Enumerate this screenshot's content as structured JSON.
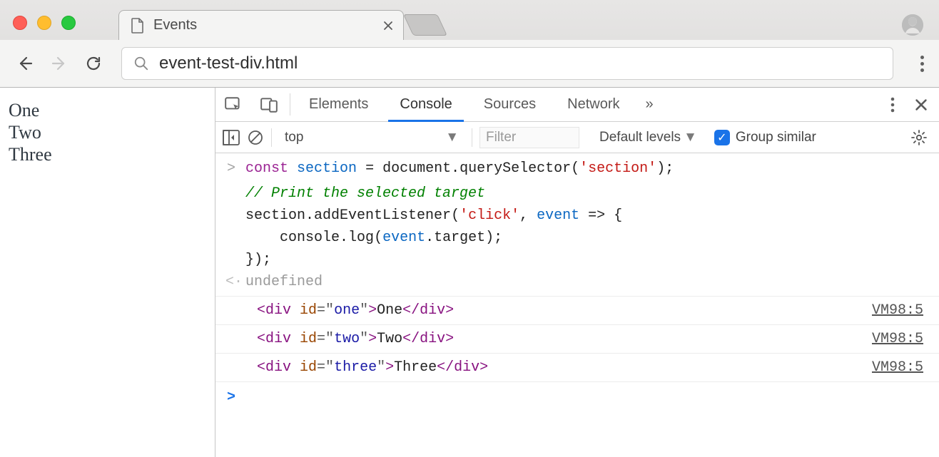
{
  "tab": {
    "title": "Events"
  },
  "omnibox": {
    "value": "event-test-div.html"
  },
  "page": {
    "items": [
      "One",
      "Two",
      "Three"
    ]
  },
  "devtools": {
    "tabs": [
      "Elements",
      "Console",
      "Sources",
      "Network"
    ],
    "active_tab": "Console",
    "overflow_glyph": "»"
  },
  "console_toolbar": {
    "context": "top",
    "filter_placeholder": "Filter",
    "levels_label": "Default levels",
    "group_similar_label": "Group similar",
    "group_similar_checked": true
  },
  "console": {
    "input_lines": [
      {
        "indent": 0,
        "tokens": [
          {
            "t": "kw",
            "v": "const"
          },
          {
            "t": "sp",
            "v": " "
          },
          {
            "t": "var",
            "v": "section"
          },
          {
            "t": "sp",
            "v": " "
          },
          {
            "t": "punct",
            "v": "= "
          },
          {
            "t": "ident",
            "v": "document"
          },
          {
            "t": "punct",
            "v": "."
          },
          {
            "t": "ident",
            "v": "querySelector"
          },
          {
            "t": "punct",
            "v": "("
          },
          {
            "t": "str",
            "v": "'section'"
          },
          {
            "t": "punct",
            "v": ");"
          }
        ]
      },
      {
        "indent": 0,
        "tokens": [
          {
            "t": "sp",
            "v": ""
          }
        ]
      },
      {
        "indent": 0,
        "tokens": [
          {
            "t": "com",
            "v": "// Print the selected target"
          }
        ]
      },
      {
        "indent": 0,
        "tokens": [
          {
            "t": "ident",
            "v": "section"
          },
          {
            "t": "punct",
            "v": "."
          },
          {
            "t": "ident",
            "v": "addEventListener"
          },
          {
            "t": "punct",
            "v": "("
          },
          {
            "t": "str",
            "v": "'click'"
          },
          {
            "t": "punct",
            "v": ", "
          },
          {
            "t": "var",
            "v": "event"
          },
          {
            "t": "sp",
            "v": " "
          },
          {
            "t": "punct",
            "v": "=> {"
          }
        ]
      },
      {
        "indent": 1,
        "tokens": [
          {
            "t": "ident",
            "v": "console"
          },
          {
            "t": "punct",
            "v": "."
          },
          {
            "t": "ident",
            "v": "log"
          },
          {
            "t": "punct",
            "v": "("
          },
          {
            "t": "var",
            "v": "event"
          },
          {
            "t": "punct",
            "v": "."
          },
          {
            "t": "ident",
            "v": "target"
          },
          {
            "t": "punct",
            "v": ");"
          }
        ]
      },
      {
        "indent": 0,
        "tokens": [
          {
            "t": "punct",
            "v": "});"
          }
        ]
      }
    ],
    "return_value": "undefined",
    "log_elements": [
      {
        "tag": "div",
        "attr": "id",
        "val": "one",
        "text": "One",
        "src": "VM98:5"
      },
      {
        "tag": "div",
        "attr": "id",
        "val": "two",
        "text": "Two",
        "src": "VM98:5"
      },
      {
        "tag": "div",
        "attr": "id",
        "val": "three",
        "text": "Three",
        "src": "VM98:5"
      }
    ]
  }
}
